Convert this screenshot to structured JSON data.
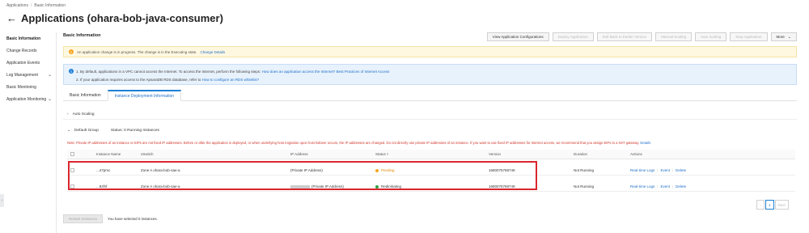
{
  "breadcrumb": [
    "Applications",
    "/",
    "Basic Information"
  ],
  "page_title": "Applications (ohara-bob-java-consumer)",
  "sidebar": {
    "items": [
      {
        "label": "Basic Information",
        "active": true,
        "expandable": false
      },
      {
        "label": "Change Records",
        "active": false,
        "expandable": false
      },
      {
        "label": "Application Events",
        "active": false,
        "expandable": false
      },
      {
        "label": "Log Management",
        "active": false,
        "expandable": true
      },
      {
        "label": "Basic Monitoring",
        "active": false,
        "expandable": false
      },
      {
        "label": "Application Monitoring",
        "active": false,
        "expandable": true
      }
    ]
  },
  "section_title": "Basic Information",
  "toolbar": {
    "view_config": "View Application Configurations",
    "deploy": "Deploy Application",
    "rollback": "Roll Back to Earlier Version",
    "manual_scaling": "Manual Scaling",
    "auto_scaling": "Auto Scaling",
    "stop": "Stop Application",
    "more": "More"
  },
  "warning": {
    "text": "An application change is in progress. The change is in the Executing state.",
    "link": "Change Details"
  },
  "info": {
    "line1_text": "1. By default, applications in a VPC cannot access the Internet. To access the Internet, perform the following steps:",
    "line1_link1": "How does an application access the Internet?",
    "line1_link2": "Best Practices of Internet Access",
    "line2_text": "2. If your application requires access to the ApsaraDB RDS database, refer to",
    "line2_link": "How to configure an RDS whitelist?"
  },
  "tabs": [
    "Basic Information",
    "Instance Deployment Information"
  ],
  "active_tab": 1,
  "auto_scaling_label": "Auto Scaling",
  "group": {
    "label": "Default Group",
    "status": "Status: 0 Running Instances"
  },
  "note": {
    "text": "Note: Private IP addresses of an instance or EIPs are not fixed IP addresses. Before or after the application is deployed, or when underlying host migration upon host failover occurs, the IP addresses are changed. Do not directly use private IP addresses of an instance. If you want to use fixed IP addresses for Internet access, we recommend that you assign EIPs to a NAT gateway.",
    "link": "Details"
  },
  "table": {
    "headers": [
      "Instance Name",
      "vSwitch",
      "IP Address",
      "Status",
      "Version",
      "Duration",
      "Actions"
    ],
    "rows": [
      {
        "name": "...47pmc",
        "vswitch": "Zone A ohara-bob-sae-a",
        "ip": "(Private IP Address)",
        "ip_masked": false,
        "status": "Pending",
        "version": "1680075769749",
        "duration": "Not Running"
      },
      {
        "name": "...9zlhf",
        "vswitch": "Zone A ohara-bob-sae-a",
        "ip": "(Private IP Address)",
        "ip_masked": true,
        "status": "Redirvkating",
        "version": "1680075769749",
        "duration": "Not Running"
      }
    ],
    "action_labels": [
      "Real-time Logs",
      "Event",
      "Delete"
    ]
  },
  "pagination": {
    "prev": "Previous",
    "current": "1",
    "next": "Next"
  },
  "bottom": {
    "restart": "Restart Instances",
    "selected_text": "You have selected 0 instances."
  },
  "colors": {
    "accent": "#1e7fd6",
    "warning": "#f5a623",
    "danger": "#d9262e",
    "success": "#2ea043"
  }
}
